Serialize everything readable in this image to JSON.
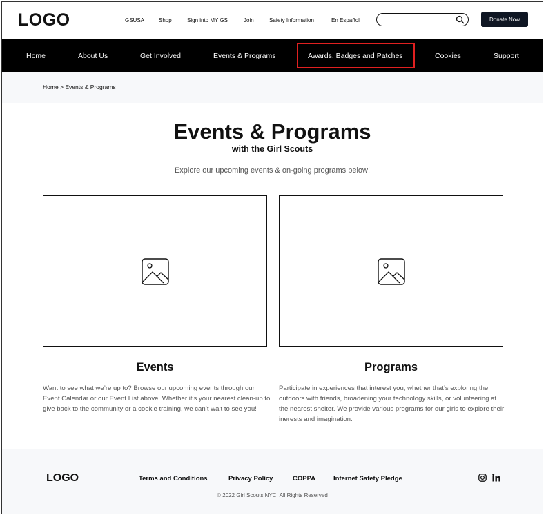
{
  "header": {
    "logo": "LOGO",
    "utility_links": [
      "GSUSA",
      "Shop",
      "Sign into MY GS",
      "Join",
      "Safety Information",
      "En Español"
    ],
    "search_placeholder": "",
    "donate_label": "Donate Now"
  },
  "nav": {
    "items": [
      "Home",
      "About Us",
      "Get Involved",
      "Events & Programs",
      "Awards, Badges and Patches",
      "Cookies",
      "Support"
    ],
    "highlight_color": "#e02020"
  },
  "breadcrumb": "Home > Events & Programs",
  "hero": {
    "title": "Events & Programs",
    "subtitle": "with the Girl Scouts",
    "intro": "Explore our upcoming events & on-going programs below!"
  },
  "cards": [
    {
      "title": "Events",
      "text": "Want to see what we’re up to? Browse our upcoming events through our Event Calendar or our Event List above. Whether it’s your nearest clean-up to give back to the community or a cookie training, we can’t wait to see you!",
      "image_icon": "image-placeholder-icon"
    },
    {
      "title": "Programs",
      "text": "Participate in experiences that interest you, whether that’s exploring the outdoors with friends, broadening your technology skills, or volunteering at the nearest shelter. We provide various programs for our girls to explore their inerests and imagination.",
      "image_icon": "image-placeholder-icon"
    }
  ],
  "footer": {
    "logo": "LOGO",
    "links": [
      "Terms and Conditions",
      "Privacy Policy",
      "COPPA",
      "Internet Safety Pledge"
    ],
    "copyright": "© 2022 Girl Scouts NYC. All Rights Reserved",
    "social_icons": [
      "instagram-icon",
      "linkedin-icon"
    ]
  },
  "colors": {
    "nav_background": "#000000",
    "donate_background": "#0f1623",
    "band_background": "#f7f8fa"
  }
}
